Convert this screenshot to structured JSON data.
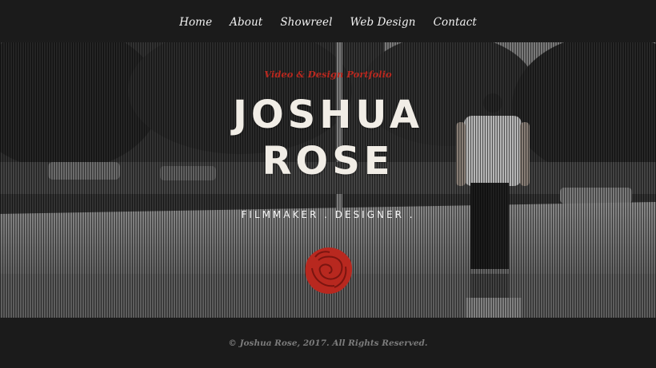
{
  "nav": {
    "items": [
      {
        "label": "Home"
      },
      {
        "label": "About"
      },
      {
        "label": "Showreel"
      },
      {
        "label": "Web Design"
      },
      {
        "label": "Contact"
      }
    ]
  },
  "hero": {
    "tagline": "Video & Design Portfolio",
    "name_line1": "JOSHUA",
    "name_line2": "ROSE",
    "subtitle": "FILMMAKER . DESIGNER .",
    "background_image": "man-walking-in-park-photo",
    "logo_icon": "red-rose-icon"
  },
  "footer": {
    "copyright": "© Joshua Rose, 2017. All Rights Reserved."
  },
  "colors": {
    "background": "#1b1b1b",
    "accent_red": "#b8281f",
    "headline": "#f1ede6",
    "footer_text": "#7b7b7b"
  }
}
